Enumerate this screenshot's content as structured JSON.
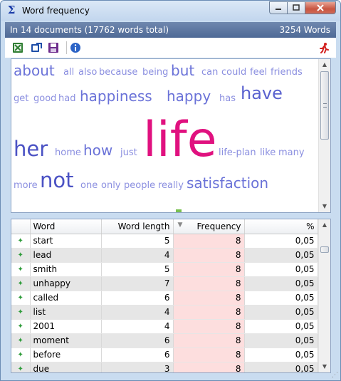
{
  "window": {
    "title": "Word frequency",
    "icon": "sigma-icon",
    "buttons": {
      "minimize": "minimize-icon",
      "maximize": "maximize-icon",
      "close": "close-icon"
    }
  },
  "infobar": {
    "summary": "In 14 documents  (17762 words total)",
    "word_count": "3254 Words"
  },
  "toolbar": {
    "icons": [
      "export-excel-icon",
      "export-icon",
      "save-icon",
      "info-icon",
      "run-icon"
    ]
  },
  "cloud": {
    "words": [
      {
        "text": "about"
      },
      {
        "text": "all"
      },
      {
        "text": "also"
      },
      {
        "text": "because"
      },
      {
        "text": "being"
      },
      {
        "text": "but"
      },
      {
        "text": "can"
      },
      {
        "text": "could"
      },
      {
        "text": "feel"
      },
      {
        "text": "friends"
      },
      {
        "text": "get"
      },
      {
        "text": "good"
      },
      {
        "text": "had"
      },
      {
        "text": "happiness"
      },
      {
        "text": "happy"
      },
      {
        "text": "has"
      },
      {
        "text": "have"
      },
      {
        "text": "her"
      },
      {
        "text": "home"
      },
      {
        "text": "how"
      },
      {
        "text": "just"
      },
      {
        "text": "life"
      },
      {
        "text": "life-plan"
      },
      {
        "text": "like"
      },
      {
        "text": "many"
      },
      {
        "text": "more"
      },
      {
        "text": "not"
      },
      {
        "text": "one"
      },
      {
        "text": "only"
      },
      {
        "text": "people"
      },
      {
        "text": "really"
      },
      {
        "text": "satisfaction"
      }
    ]
  },
  "table": {
    "headers": {
      "mark": "",
      "word": "Word",
      "word_length": "Word length",
      "frequency": "Frequency",
      "percent": "%"
    },
    "rows": [
      {
        "word": "start",
        "length": "5",
        "freq": "8",
        "pct": "0,05"
      },
      {
        "word": "lead",
        "length": "4",
        "freq": "8",
        "pct": "0,05"
      },
      {
        "word": "smith",
        "length": "5",
        "freq": "8",
        "pct": "0,05"
      },
      {
        "word": "unhappy",
        "length": "7",
        "freq": "8",
        "pct": "0,05"
      },
      {
        "word": "called",
        "length": "6",
        "freq": "8",
        "pct": "0,05"
      },
      {
        "word": "list",
        "length": "4",
        "freq": "8",
        "pct": "0,05"
      },
      {
        "word": "2001",
        "length": "4",
        "freq": "8",
        "pct": "0,05"
      },
      {
        "word": "moment",
        "length": "6",
        "freq": "8",
        "pct": "0,05"
      },
      {
        "word": "before",
        "length": "6",
        "freq": "8",
        "pct": "0,05"
      },
      {
        "word": "due",
        "length": "3",
        "freq": "8",
        "pct": "0,05"
      }
    ]
  }
}
